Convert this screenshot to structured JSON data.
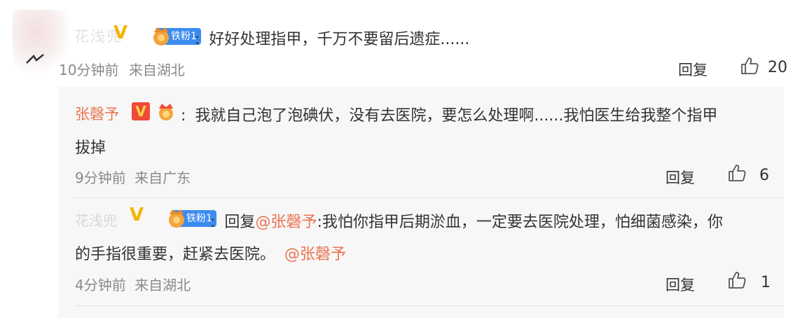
{
  "main_comment": {
    "username": "花浅兜",
    "fan_badge": "铁粉1",
    "separator": ":",
    "text": "好好处理指甲，千万不要留后遗症......",
    "time": "10分钟前",
    "location": "来自湖北",
    "reply_label": "回复",
    "like_count": "20"
  },
  "replies": [
    {
      "username": "张磬予",
      "separator": ":",
      "text_line1": "我就自己泡了泡碘伏，没有去医院，要怎么处理啊......我怕医生给我整个指甲",
      "text_line2": "拔掉",
      "time": "9分钟前",
      "location": "来自广东",
      "reply_label": "回复",
      "like_count": "6"
    },
    {
      "username": "花浅兜",
      "fan_badge": "铁粉1",
      "separator": ":",
      "reply_prefix": "回复",
      "mention": "@张磬予",
      "text_line1_rest": ":我怕你指甲后期淤血，一定要去医院处理，怕细菌感染，你",
      "text_line2": "的手指很重要，赶紧去医院。",
      "mention_end": "@张磬予",
      "time": "4分钟前",
      "location": "来自湖北",
      "reply_label": "回复",
      "like_count": "1"
    }
  ],
  "colors": {
    "accent": "#eb7350",
    "vip_gold": "#f4b400",
    "badge_blue": "#3c8cf0",
    "panel_bg": "#f7f7f7"
  },
  "icons": [
    "thumbs-up-icon",
    "crown-icon",
    "vip-icon"
  ]
}
